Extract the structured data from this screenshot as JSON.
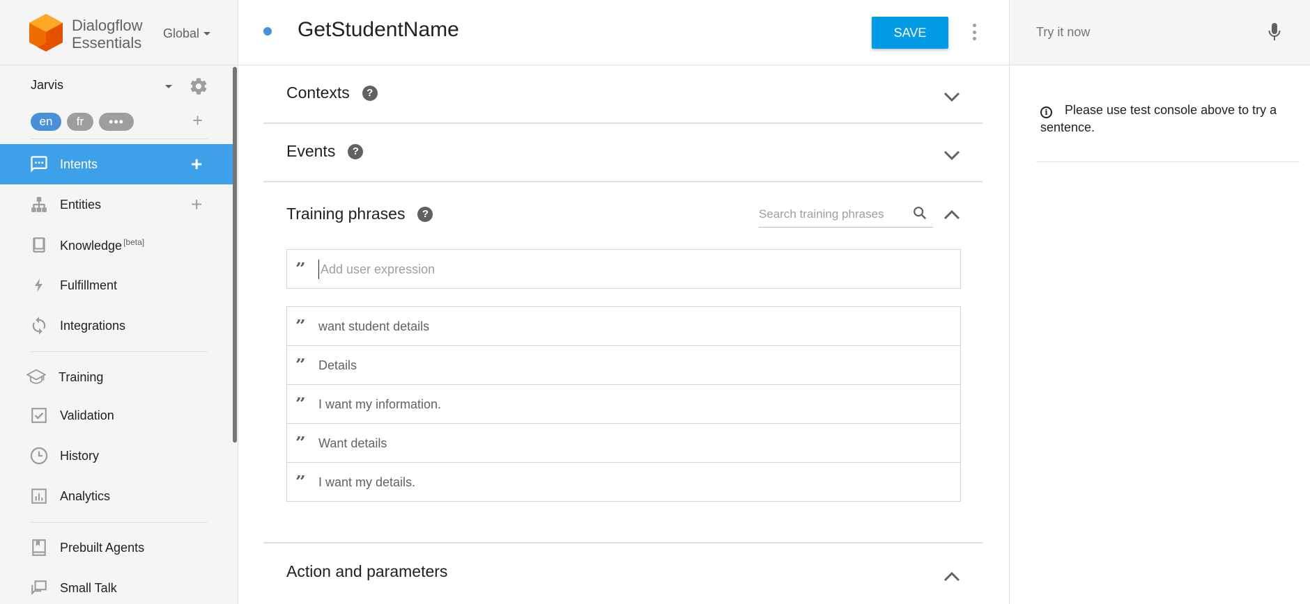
{
  "brand": {
    "line1": "Dialogflow",
    "line2": "Essentials",
    "region": "Global"
  },
  "agent": {
    "name": "Jarvis",
    "languages": [
      "en",
      "fr"
    ],
    "more_langs": "•••"
  },
  "nav": {
    "intents": "Intents",
    "entities": "Entities",
    "knowledge": "Knowledge",
    "knowledge_tag": "[beta]",
    "fulfillment": "Fulfillment",
    "integrations": "Integrations",
    "training": "Training",
    "validation": "Validation",
    "history": "History",
    "analytics": "Analytics",
    "prebuilt_agents": "Prebuilt Agents",
    "small_talk": "Small Talk"
  },
  "intent": {
    "title": "GetStudentName",
    "save_label": "SAVE"
  },
  "sections": {
    "contexts": "Contexts",
    "events": "Events",
    "training_phrases": "Training phrases",
    "action_parameters": "Action and parameters",
    "help_glyph": "?"
  },
  "training": {
    "search_placeholder": "Search training phrases",
    "add_placeholder": "Add user expression",
    "quote_glyph": "”",
    "phrases": [
      "want student details",
      "Details",
      "I want my information.",
      "Want details",
      "I want my details."
    ]
  },
  "console": {
    "placeholder": "Try it now",
    "info_glyph": "i",
    "info_text": "Please use test console above to try a sentence."
  },
  "colors": {
    "primary": "#039be5",
    "active_nav": "#3da0e8",
    "logo": "#ef6c00"
  },
  "icons": {
    "intents": "chat-bubble-icon",
    "entities": "hierarchy-icon",
    "knowledge": "book-icon",
    "fulfillment": "bolt-icon",
    "integrations": "sync-icon",
    "training": "graduation-cap-icon",
    "validation": "check-box-icon",
    "history": "clock-icon",
    "analytics": "bar-chart-icon",
    "prebuilt_agents": "bookmark-book-icon",
    "small_talk": "chat-copy-icon"
  }
}
